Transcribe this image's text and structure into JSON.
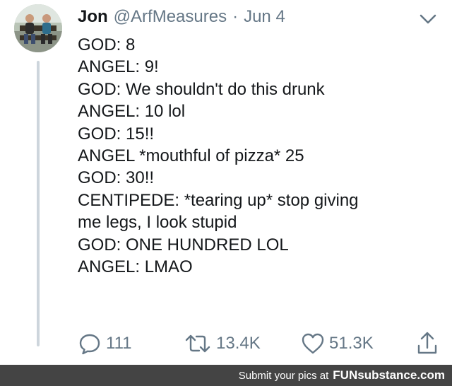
{
  "tweet": {
    "author_name": "Jon",
    "handle": "@ArfMeasures",
    "separator": "·",
    "date": "Jun 4",
    "lines": [
      "GOD: 8",
      "ANGEL: 9!",
      "GOD: We shouldn't do this drunk",
      "ANGEL: 10 lol",
      "GOD: 15!!",
      "ANGEL *mouthful of pizza* 25",
      "GOD: 30!!",
      "CENTIPEDE: *tearing up* stop giving",
      "me legs, I look stupid",
      "GOD: ONE HUNDRED LOL",
      "ANGEL: LMAO"
    ]
  },
  "actions": {
    "reply": {
      "icon": "reply-icon",
      "count": "111"
    },
    "retweet": {
      "icon": "retweet-icon",
      "count": "13.4K"
    },
    "like": {
      "icon": "heart-icon",
      "count": "51.3K"
    },
    "share": {
      "icon": "share-icon"
    }
  },
  "footer": {
    "prefix": "Submit your pics at",
    "site": "FUNsubstance.com"
  },
  "colors": {
    "text": "#14171a",
    "secondary": "#657786",
    "thread_line": "#cdd5dc",
    "footer_bg": "#444444"
  }
}
